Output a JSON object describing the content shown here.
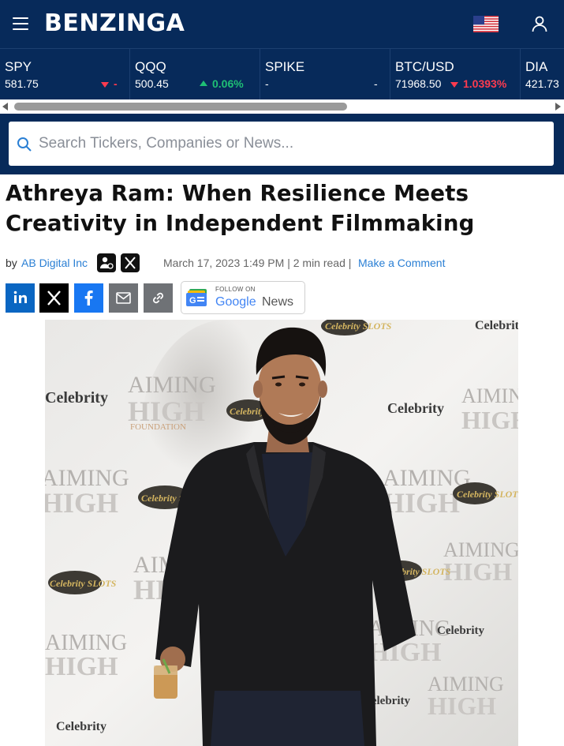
{
  "header": {
    "logo": "BENZINGA",
    "menu_icon": "hamburger-icon",
    "flag_icon": "us-flag-icon",
    "account_icon": "user-icon"
  },
  "tickers": [
    {
      "symbol": "SPY",
      "price": "581.75",
      "change": "-",
      "direction": "down"
    },
    {
      "symbol": "QQQ",
      "price": "500.45",
      "change": "0.06%",
      "direction": "up"
    },
    {
      "symbol": "SPIKE",
      "price": "-",
      "change": "-",
      "direction": "flat"
    },
    {
      "symbol": "BTC/USD",
      "price": "71968.50",
      "change": "1.0393%",
      "direction": "down"
    },
    {
      "symbol": "DIA",
      "price": "421.73",
      "change": "",
      "direction": "flat"
    }
  ],
  "search": {
    "placeholder": "Search Tickers, Companies or News..."
  },
  "article": {
    "title": "Athreya Ram: When Resilience Meets Creativity in Independent Filmmaking",
    "by": "by",
    "author": "AB Digital Inc",
    "meta": "March 17, 2023 1:49 PM | 2 min read |",
    "comment_link": "Make a Comment"
  },
  "share": {
    "google_news_follow": "FOLLOW ON",
    "google_news_google": "Google",
    "google_news_news": "News"
  },
  "photo": {
    "backdrop_aiming": "AIMING",
    "backdrop_high": "HIGH",
    "backdrop_foundation": "FOUNDATION",
    "backdrop_celebrity": "Celebrity",
    "backdrop_slots": "Celebrity SLOTS"
  },
  "colors": {
    "brand_navy": "#072a5a",
    "link_blue": "#2a7fd4",
    "up_green": "#1fbf75",
    "down_red": "#ff3b4f",
    "linkedin": "#0a66c2",
    "facebook": "#1877f2",
    "email_gray": "#6f7276"
  }
}
